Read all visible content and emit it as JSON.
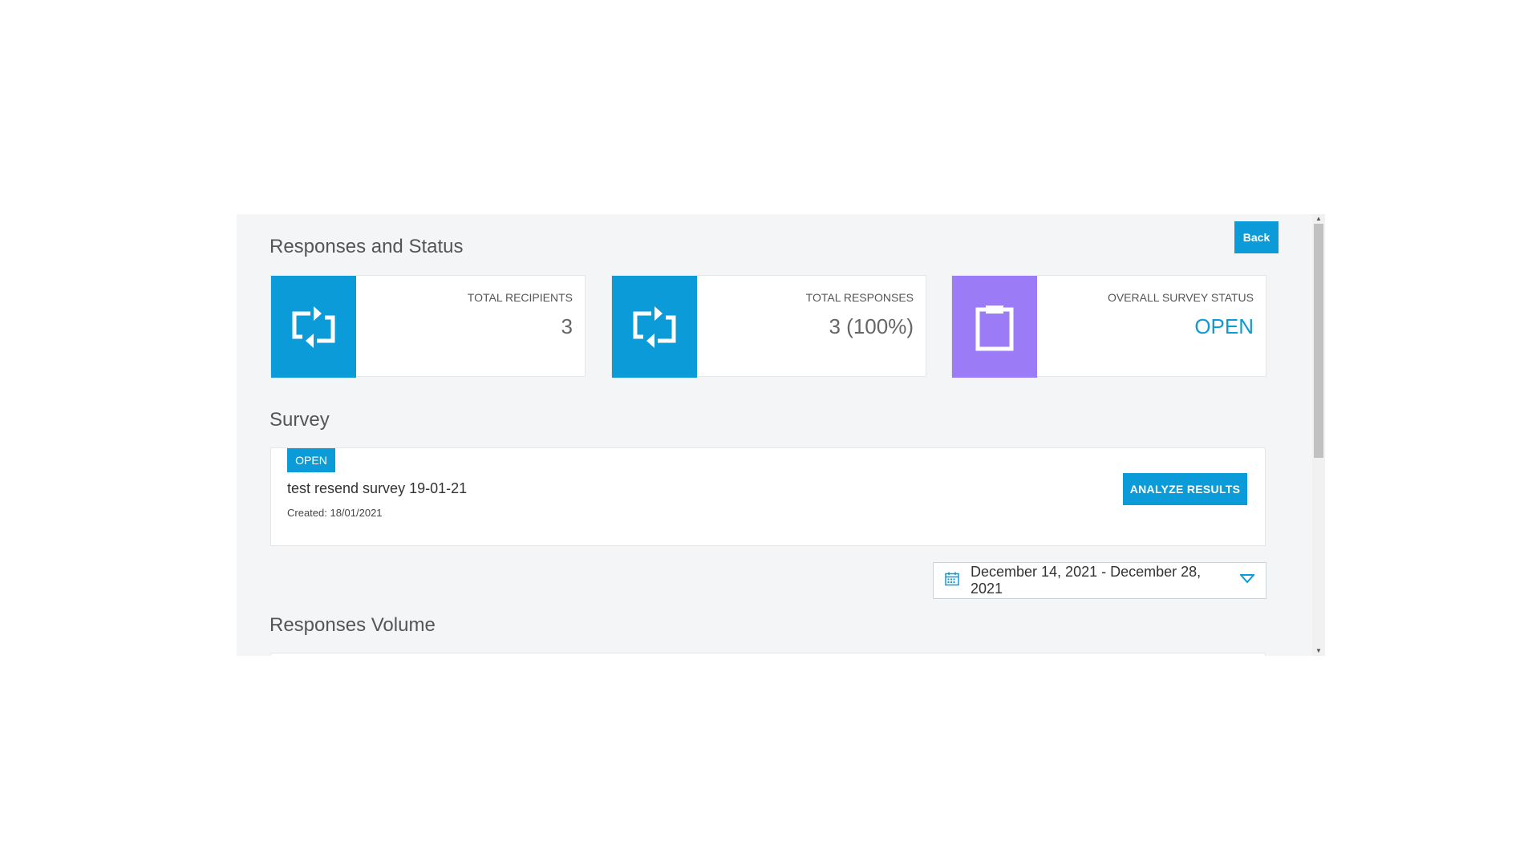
{
  "header": {
    "title": "Responses and Status",
    "back_label": "Back"
  },
  "cards": [
    {
      "label": "TOTAL RECIPIENTS",
      "value": "3",
      "icon": "repeat-icon",
      "color": "#0a9bd8"
    },
    {
      "label": "TOTAL RESPONSES",
      "value": "3 (100%)",
      "icon": "repeat-icon",
      "color": "#0a9bd8"
    },
    {
      "label": "OVERALL SURVEY STATUS",
      "value": "OPEN",
      "icon": "clipboard-icon",
      "color": "#9b7bf6"
    }
  ],
  "survey": {
    "section_title": "Survey",
    "status_badge": "OPEN",
    "name": "test resend survey 19-01-21",
    "created": "Created: 18/01/2021",
    "analyze_label": "ANALYZE RESULTS"
  },
  "date_filter": {
    "icon": "calendar-icon",
    "range": "December 14, 2021 - December 28, 2021"
  },
  "volume": {
    "section_title": "Responses Volume"
  },
  "colors": {
    "accent": "#0a9bd8",
    "purple": "#9b7bf6",
    "background": "#f4f5f7"
  }
}
